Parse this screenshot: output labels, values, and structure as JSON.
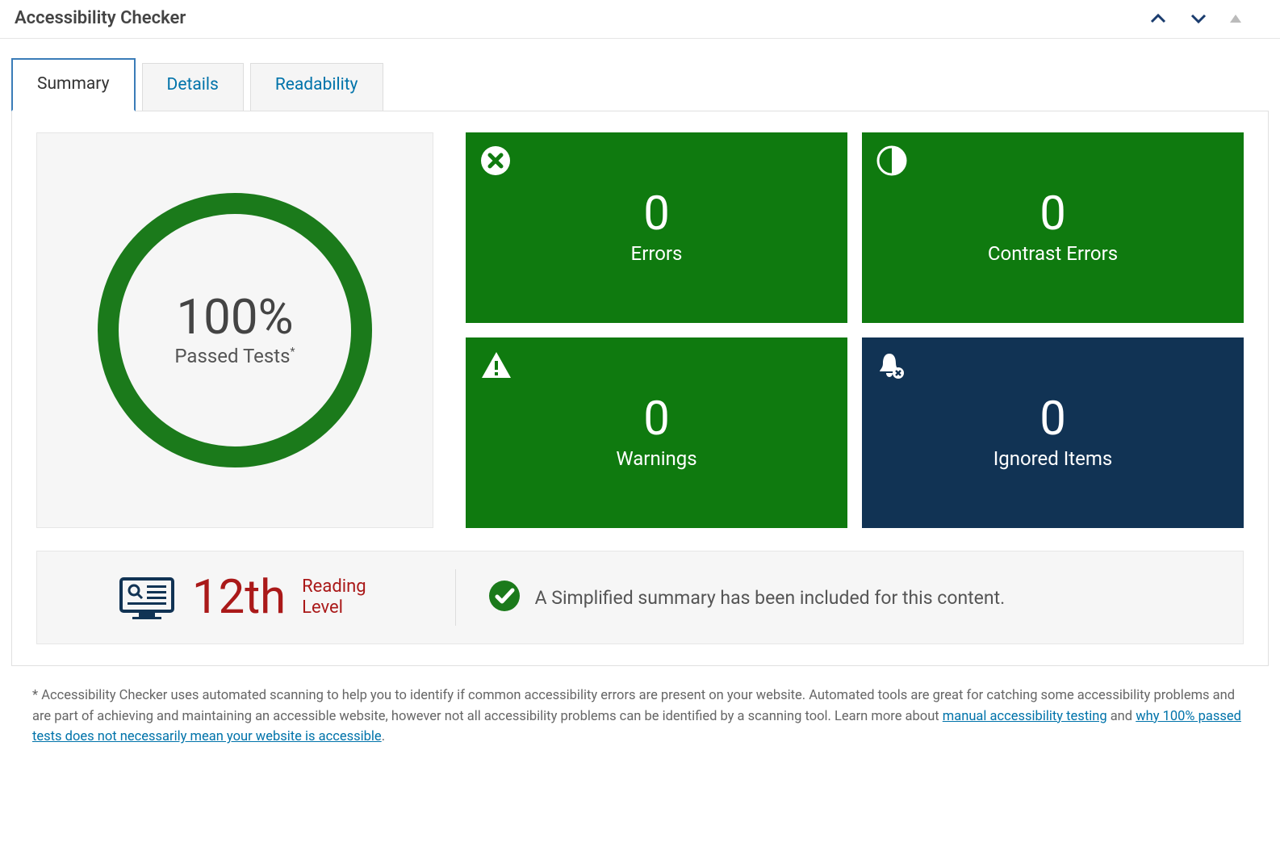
{
  "header": {
    "title": "Accessibility Checker"
  },
  "tabs": [
    {
      "label": "Summary",
      "active": true
    },
    {
      "label": "Details",
      "active": false
    },
    {
      "label": "Readability",
      "active": false
    }
  ],
  "passed": {
    "percent": "100%",
    "label": "Passed Tests",
    "asterisk": "*"
  },
  "stats": {
    "errors": {
      "value": "0",
      "label": "Errors",
      "color": "green"
    },
    "contrast": {
      "value": "0",
      "label": "Contrast Errors",
      "color": "green"
    },
    "warnings": {
      "value": "0",
      "label": "Warnings",
      "color": "green"
    },
    "ignored": {
      "value": "0",
      "label": "Ignored Items",
      "color": "navy"
    }
  },
  "reading": {
    "grade": "12th",
    "line1": "Reading",
    "line2": "Level"
  },
  "simplified": {
    "text": "A Simplified summary has been included for this content."
  },
  "footnote": {
    "prefix": "* Accessibility Checker uses automated scanning to help you to identify if common accessibility errors are present on your website. Automated tools are great for catching some accessibility problems and are part of achieving and maintaining an accessible website, however not all accessibility problems can be identified by a scanning tool. Learn more about ",
    "link1": "manual accessibility testing",
    "mid": " and ",
    "link2": "why 100% passed tests does not necessarily mean your website is accessible",
    "suffix": "."
  },
  "colors": {
    "green": "#0f7a0f",
    "navy": "#113354",
    "ring": "#1b7a1b",
    "red": "#aa1919",
    "link": "#0073aa"
  }
}
